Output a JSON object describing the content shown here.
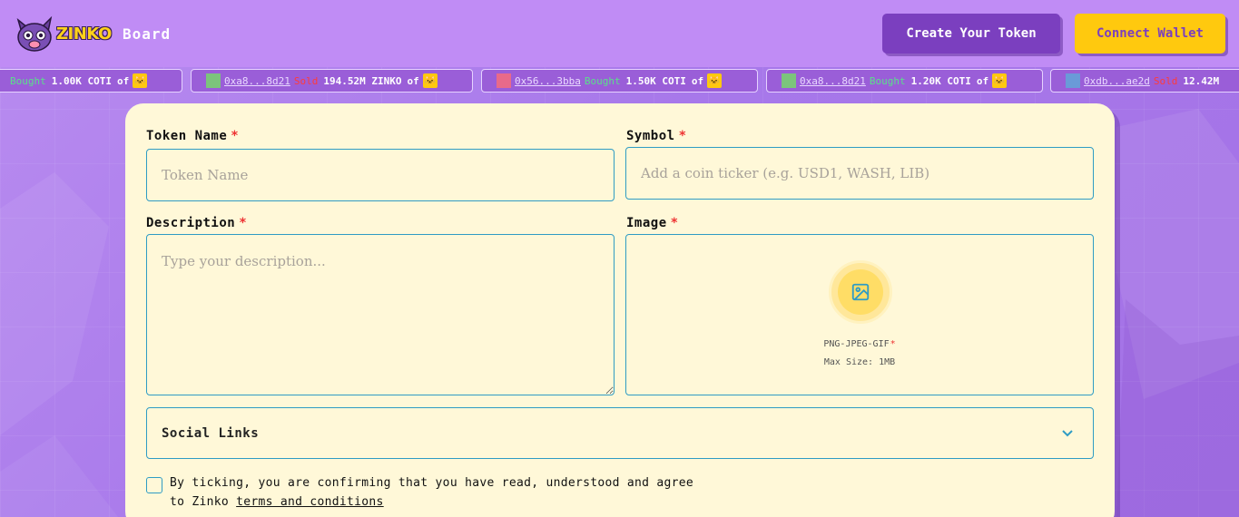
{
  "header": {
    "logo_text": "ZINKO",
    "nav_board": "Board",
    "create_button": "Create Your Token",
    "connect_button": "Connect Wallet"
  },
  "ticker": [
    {
      "address": "",
      "action": "Bought",
      "amount": "1.00K COTI",
      "of": "of"
    },
    {
      "address": "0xa8...8d21",
      "action": "Sold",
      "amount": "194.52M ZINKO",
      "of": "of"
    },
    {
      "address": "0x56...3bba",
      "action": "Bought",
      "amount": "1.50K COTI",
      "of": "of"
    },
    {
      "address": "0xa8...8d21",
      "action": "Bought",
      "amount": "1.20K COTI",
      "of": "of"
    },
    {
      "address": "0xdb...ae2d",
      "action": "Sold",
      "amount": "12.42M",
      "of": ""
    }
  ],
  "form": {
    "token_name_label": "Token Name",
    "token_name_placeholder": "Token Name",
    "symbol_label": "Symbol",
    "symbol_placeholder": "Add a coin ticker (e.g. USD1, WASH, LIB)",
    "description_label": "Description",
    "description_placeholder": "Type your description...",
    "image_label": "Image",
    "image_formats": "PNG-JPEG-GIF",
    "image_max_size": "Max Size: 1MB",
    "required_mark": "*",
    "social_links_label": "Social Links",
    "terms_text_line1": "By ticking, you are confirming that you have read, understood and agree",
    "terms_text_prefix": "to Zinko ",
    "terms_link": "terms and conditions"
  },
  "colors": {
    "accent_purple": "#7b3fbf",
    "accent_yellow": "#ffc90e",
    "card_bg": "#fff8d8",
    "border_blue": "#2f9cc4",
    "required_red": "#e33333"
  }
}
